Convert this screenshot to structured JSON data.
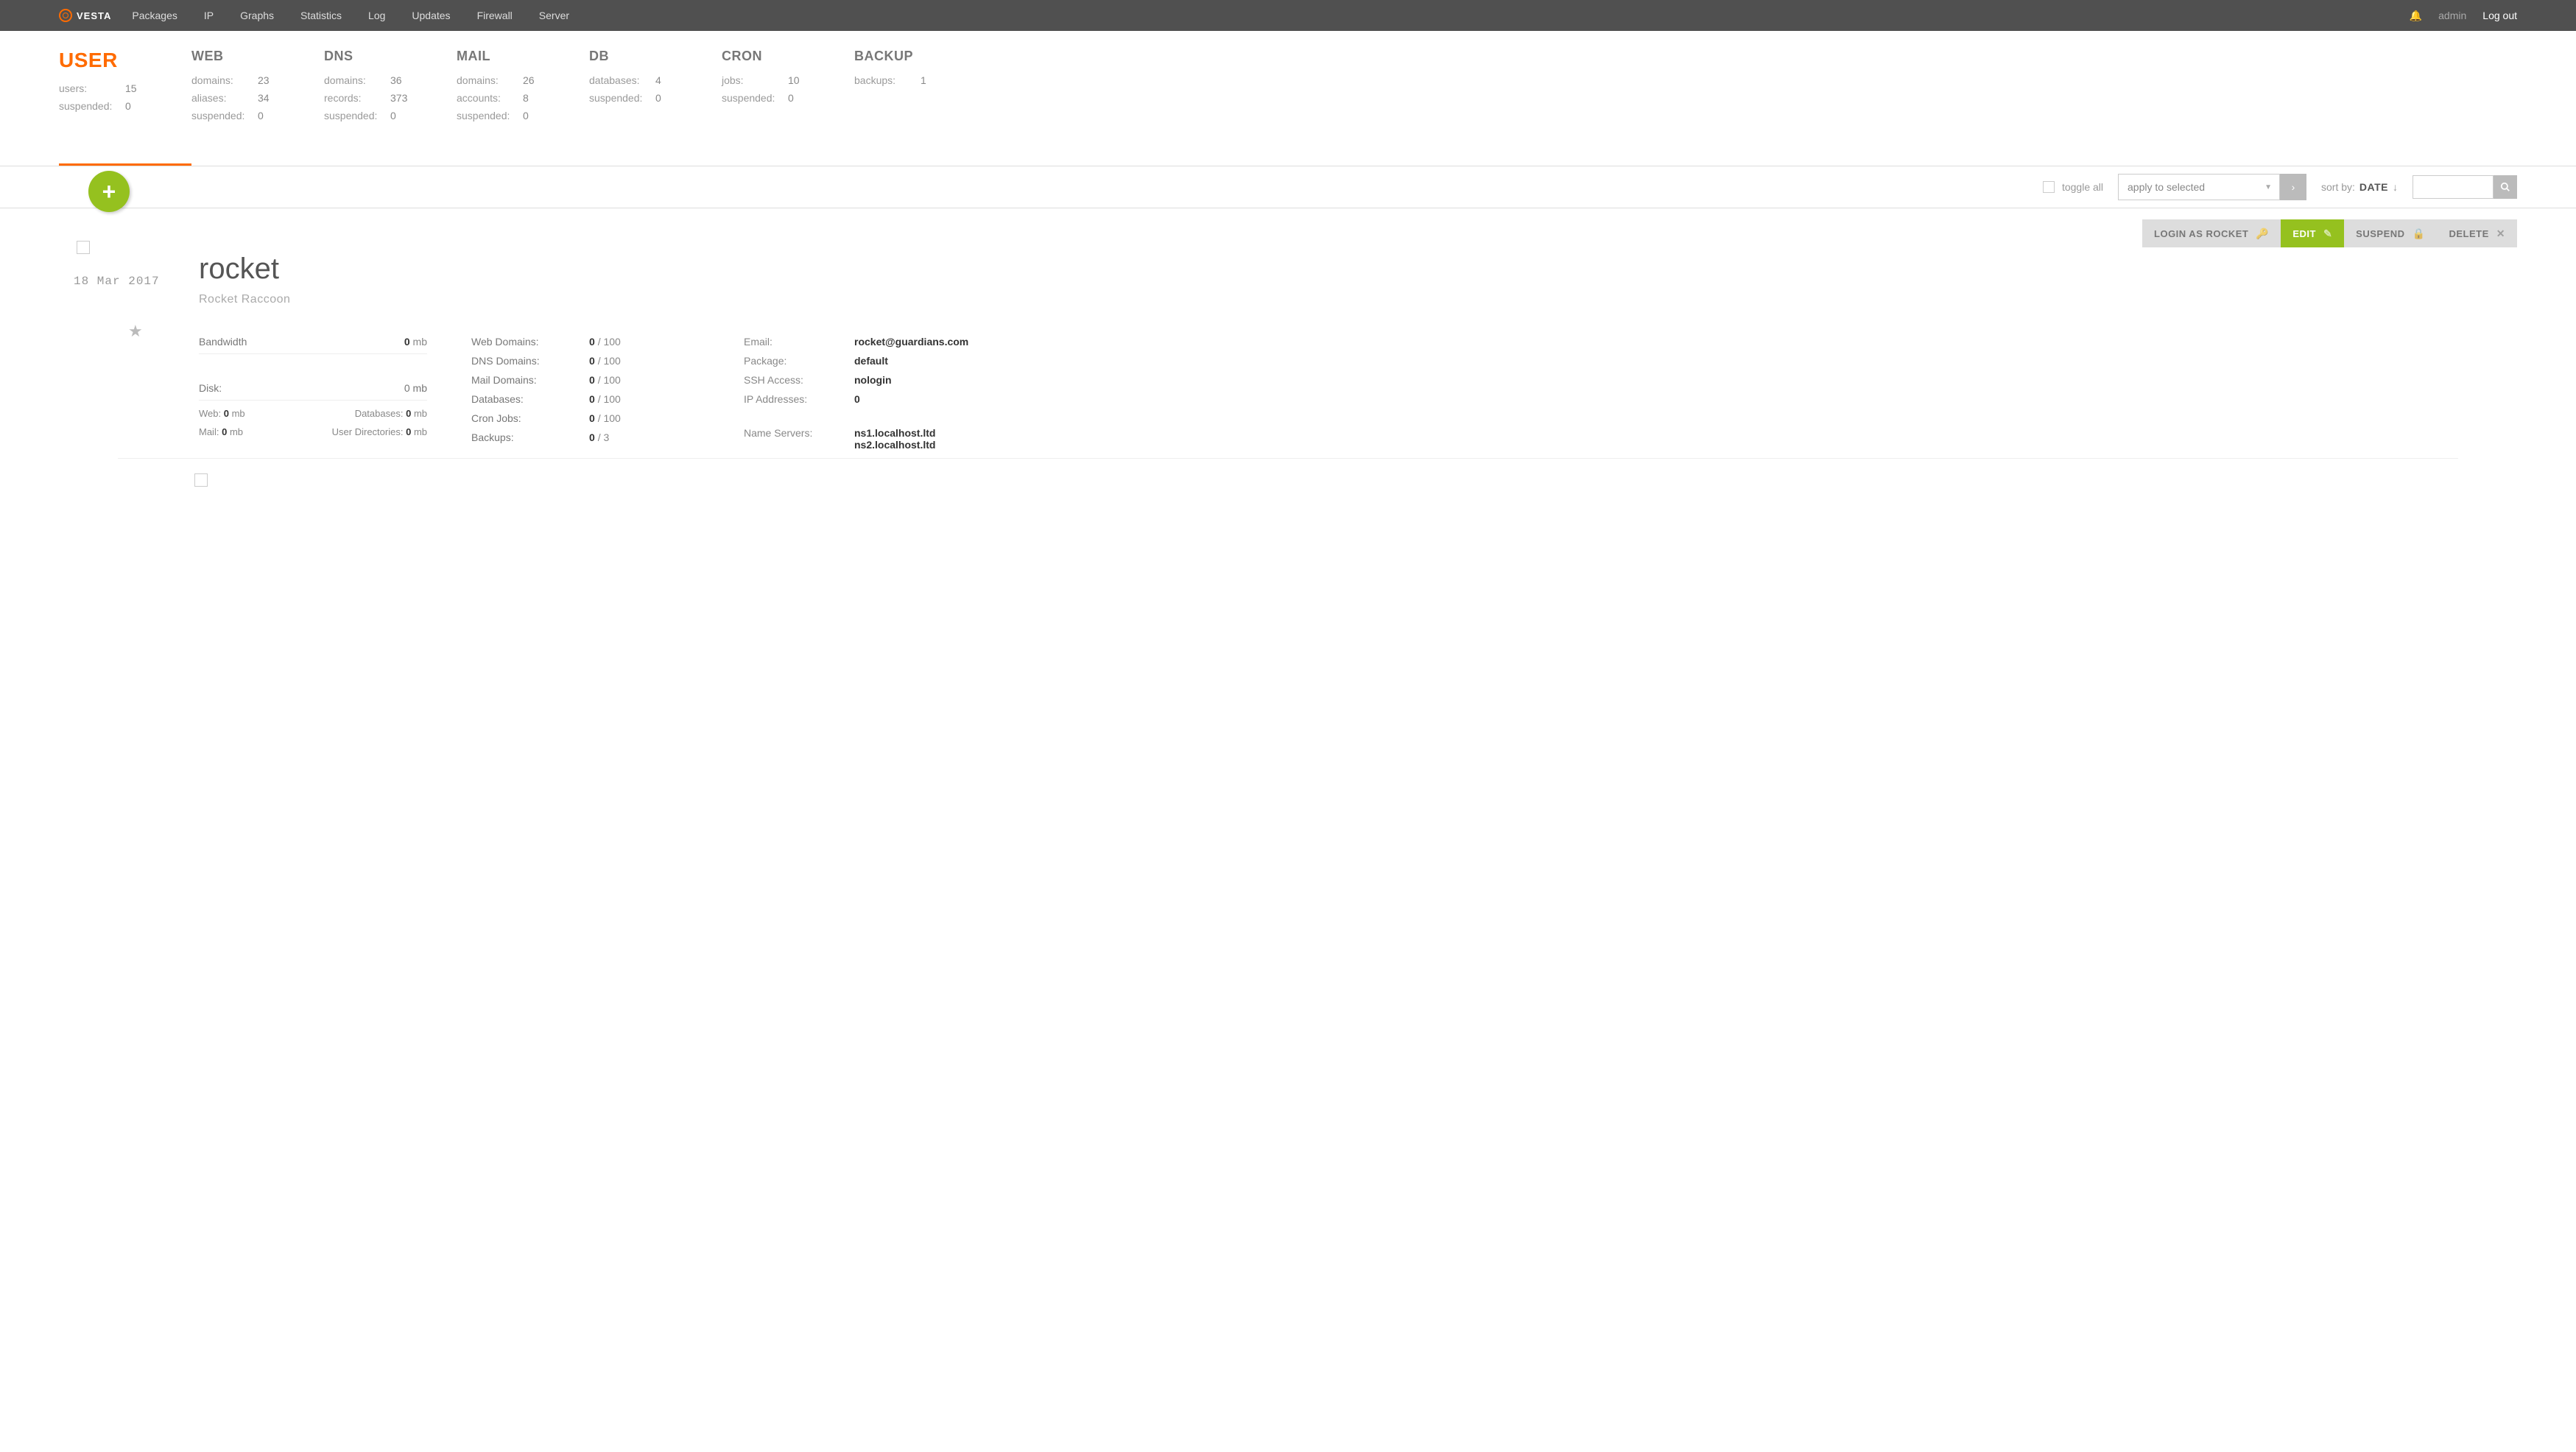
{
  "brand": "VESTA",
  "topnav": [
    "Packages",
    "IP",
    "Graphs",
    "Statistics",
    "Log",
    "Updates",
    "Firewall",
    "Server"
  ],
  "user_label": "admin",
  "logout_label": "Log out",
  "stats": {
    "user": {
      "title": "USER",
      "r1l": "users:",
      "r1v": "15",
      "r2l": "suspended:",
      "r2v": "0"
    },
    "web": {
      "title": "WEB",
      "r1l": "domains:",
      "r1v": "23",
      "r2l": "aliases:",
      "r2v": "34",
      "r3l": "suspended:",
      "r3v": "0"
    },
    "dns": {
      "title": "DNS",
      "r1l": "domains:",
      "r1v": "36",
      "r2l": "records:",
      "r2v": "373",
      "r3l": "suspended:",
      "r3v": "0"
    },
    "mail": {
      "title": "MAIL",
      "r1l": "domains:",
      "r1v": "26",
      "r2l": "accounts:",
      "r2v": "8",
      "r3l": "suspended:",
      "r3v": "0"
    },
    "db": {
      "title": "DB",
      "r1l": "databases:",
      "r1v": "4",
      "r2l": "suspended:",
      "r2v": "0"
    },
    "cron": {
      "title": "CRON",
      "r1l": "jobs:",
      "r1v": "10",
      "r2l": "suspended:",
      "r2v": "0"
    },
    "backup": {
      "title": "BACKUP",
      "r1l": "backups:",
      "r1v": "1"
    }
  },
  "toolbar": {
    "toggle_all": "toggle all",
    "apply": "apply to selected",
    "sort_label": "sort by:",
    "sort_value": "DATE",
    "sort_arrow": "↓"
  },
  "actions": {
    "login": "LOGIN AS ROCKET",
    "edit": "EDIT",
    "suspend": "SUSPEND",
    "delete": "DELETE"
  },
  "card": {
    "date": "18 Mar 2017",
    "username": "rocket",
    "fullname": "Rocket Raccoon",
    "bw_label": "Bandwidth",
    "bw_val": "0",
    "bw_unit": "mb",
    "disk_label": "Disk:",
    "disk_val": "0",
    "disk_unit": "mb",
    "sub_web_l": "Web:",
    "sub_web_v": "0",
    "sub_web_u": "mb",
    "sub_db_l": "Databases:",
    "sub_db_v": "0",
    "sub_db_u": "mb",
    "sub_mail_l": "Mail:",
    "sub_mail_v": "0",
    "sub_mail_u": "mb",
    "sub_ud_l": "User Directories:",
    "sub_ud_v": "0",
    "sub_ud_u": "mb",
    "usage": {
      "web": {
        "k": "Web Domains:",
        "n": "0",
        "d": "/ 100"
      },
      "dns": {
        "k": "DNS Domains:",
        "n": "0",
        "d": "/ 100"
      },
      "mail": {
        "k": "Mail Domains:",
        "n": "0",
        "d": "/ 100"
      },
      "db": {
        "k": "Databases:",
        "n": "0",
        "d": "/ 100"
      },
      "cron": {
        "k": "Cron Jobs:",
        "n": "0",
        "d": "/ 100"
      },
      "backup": {
        "k": "Backups:",
        "n": "0",
        "d": "/ 3"
      }
    },
    "info": {
      "email": {
        "k": "Email:",
        "v": "rocket@guardians.com"
      },
      "pkg": {
        "k": "Package:",
        "v": "default"
      },
      "ssh": {
        "k": "SSH Access:",
        "v": "nologin"
      },
      "ip": {
        "k": "IP Addresses:",
        "v": "0"
      },
      "ns_k": "Name Servers:",
      "ns1": "ns1.localhost.ltd",
      "ns2": "ns2.localhost.ltd"
    }
  }
}
